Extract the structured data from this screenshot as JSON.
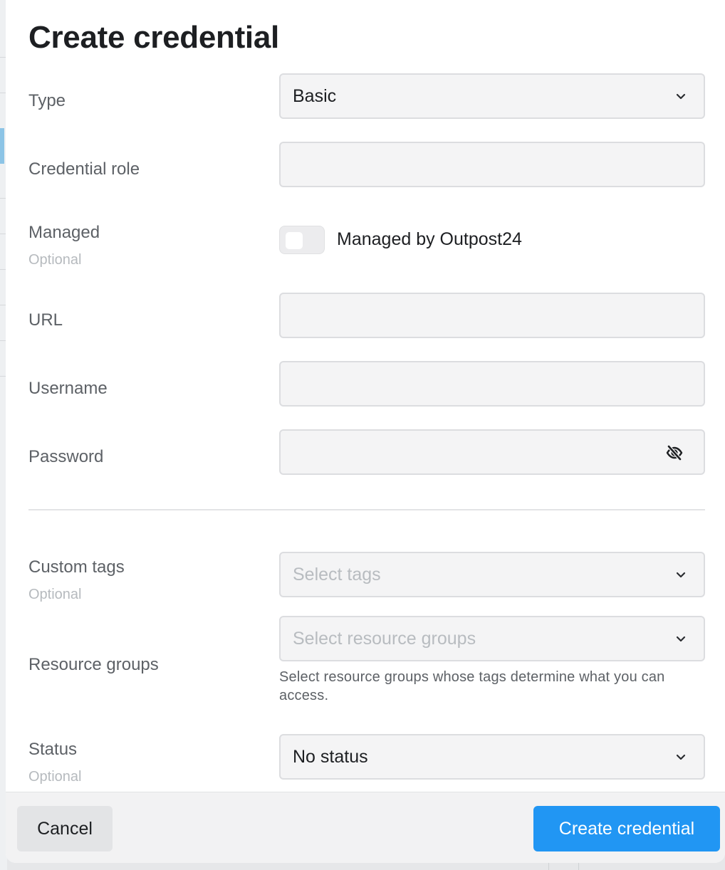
{
  "dialog": {
    "title": "Create credential",
    "fields": {
      "type": {
        "label": "Type",
        "value": "Basic"
      },
      "credential_role": {
        "label": "Credential role",
        "value": ""
      },
      "managed": {
        "label": "Managed",
        "optional": "Optional",
        "toggle_label": "Managed by Outpost24",
        "enabled": false
      },
      "url": {
        "label": "URL",
        "value": ""
      },
      "username": {
        "label": "Username",
        "value": ""
      },
      "password": {
        "label": "Password",
        "value": "",
        "visibility_icon": "eye-off-icon"
      },
      "custom_tags": {
        "label": "Custom tags",
        "optional": "Optional",
        "placeholder": "Select tags"
      },
      "resource_groups": {
        "label": "Resource groups",
        "placeholder": "Select resource groups",
        "helper": "Select resource groups whose tags determine what you can access."
      },
      "status": {
        "label": "Status",
        "optional": "Optional",
        "value": "No status"
      }
    }
  },
  "footer": {
    "cancel_label": "Cancel",
    "create_label": "Create credential"
  },
  "colors": {
    "primary": "#2196f3",
    "field_bg": "#f4f4f5",
    "text": "#1d1f22",
    "muted": "#5d6166"
  }
}
